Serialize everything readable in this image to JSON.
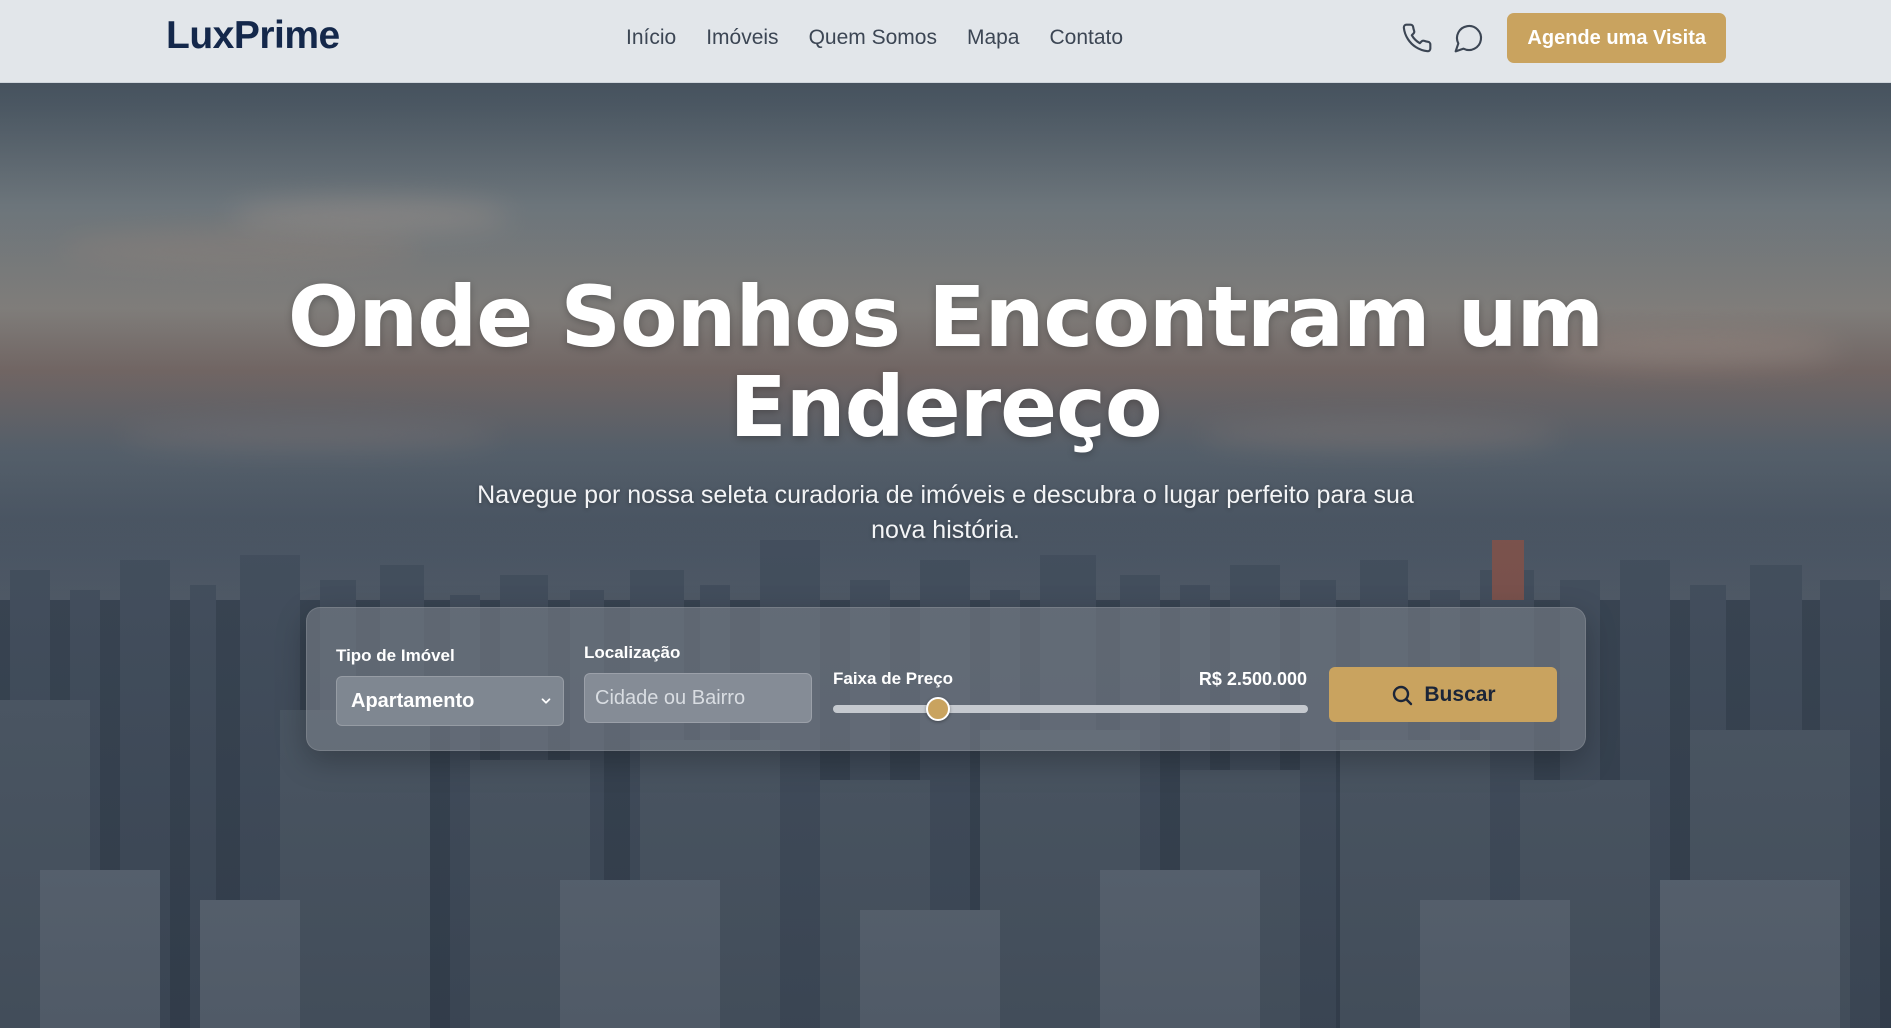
{
  "brand": {
    "logo": "LuxPrime"
  },
  "nav": {
    "links": [
      {
        "label": "Início"
      },
      {
        "label": "Imóveis"
      },
      {
        "label": "Quem Somos"
      },
      {
        "label": "Mapa"
      },
      {
        "label": "Contato"
      }
    ]
  },
  "header": {
    "phone_icon": "phone-icon",
    "chat_icon": "chat-bubble-icon",
    "cta_label": "Agende uma Visita"
  },
  "hero": {
    "title": "Onde Sonhos Encontram um Endereço",
    "subtitle": "Navegue por nossa seleta curadoria de imóveis e descubra o lugar perfeito para sua nova história."
  },
  "search": {
    "type_label": "Tipo de Imóvel",
    "type_value": "Apartamento",
    "location_label": "Localização",
    "location_placeholder": "Cidade ou Bairro",
    "location_value": "",
    "price_label": "Faixa de Preço",
    "price_value": "R$ 2.500.000",
    "price_slider_fraction": 0.22,
    "button_label": "Buscar",
    "button_icon": "search-icon"
  },
  "colors": {
    "accent": "#c9a35f",
    "brand": "#14284b",
    "header_bg": "#e2e6ea"
  }
}
